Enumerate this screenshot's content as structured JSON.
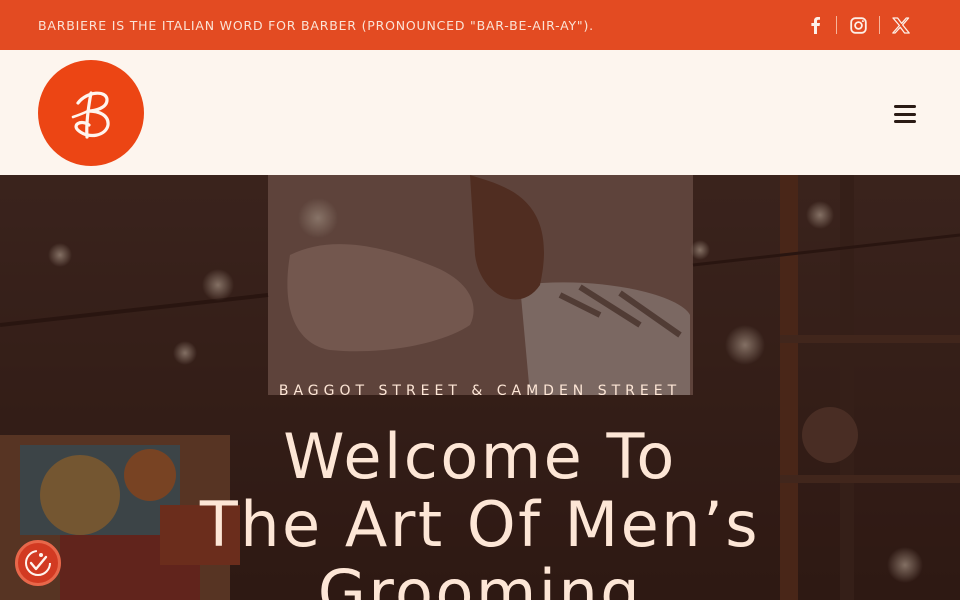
{
  "topbar": {
    "announcement": "BARBIERE IS THE ITALIAN WORD FOR BARBER (PRONOUNCED \"BAR-BE-AIR-AY\").",
    "socials": [
      "facebook-icon",
      "instagram-icon",
      "x-twitter-icon"
    ]
  },
  "header": {
    "logo_letter": "B",
    "menu_icon": "hamburger-menu-icon"
  },
  "hero": {
    "subtitle": "BAGGOT STREET & CAMDEN STREET",
    "title_line1": "Welcome To",
    "title_line2": "The Art Of Men’s",
    "title_line3": "Grooming"
  },
  "accessibility": {
    "icon": "accessibility-icon"
  },
  "colors": {
    "topbar": "#e34b22",
    "logo": "#ec4514",
    "header_bg": "#fdf5ee",
    "hero_text": "#fde6d6"
  }
}
